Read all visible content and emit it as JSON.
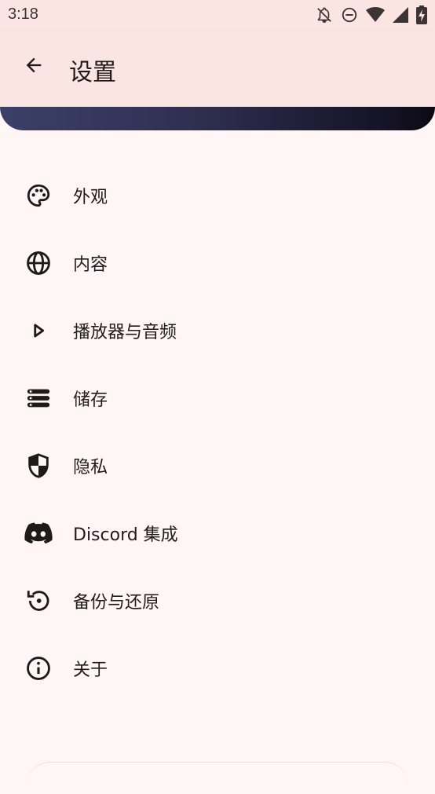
{
  "status_bar": {
    "time": "3:18",
    "icons": [
      "notifications-off-icon",
      "do-not-disturb-icon",
      "wifi-icon",
      "cellular-signal-icon",
      "battery-charging-icon"
    ]
  },
  "app_bar": {
    "title": "设置",
    "back_icon": "arrow-back-icon"
  },
  "menu": {
    "items": [
      {
        "label": "外观",
        "icon": "palette-icon"
      },
      {
        "label": "内容",
        "icon": "globe-icon"
      },
      {
        "label": "播放器与音频",
        "icon": "play-icon"
      },
      {
        "label": "储存",
        "icon": "storage-icon"
      },
      {
        "label": "隐私",
        "icon": "shield-icon"
      },
      {
        "label": "Discord 集成",
        "icon": "discord-icon"
      },
      {
        "label": "备份与还原",
        "icon": "restore-icon"
      },
      {
        "label": "关于",
        "icon": "info-icon"
      }
    ]
  },
  "colors": {
    "background": "#fff6f5",
    "app_bar": "#fbe5e2",
    "banner_start": "#3b4068",
    "banner_end": "#0b0a12",
    "text": "#1f1a1a"
  }
}
